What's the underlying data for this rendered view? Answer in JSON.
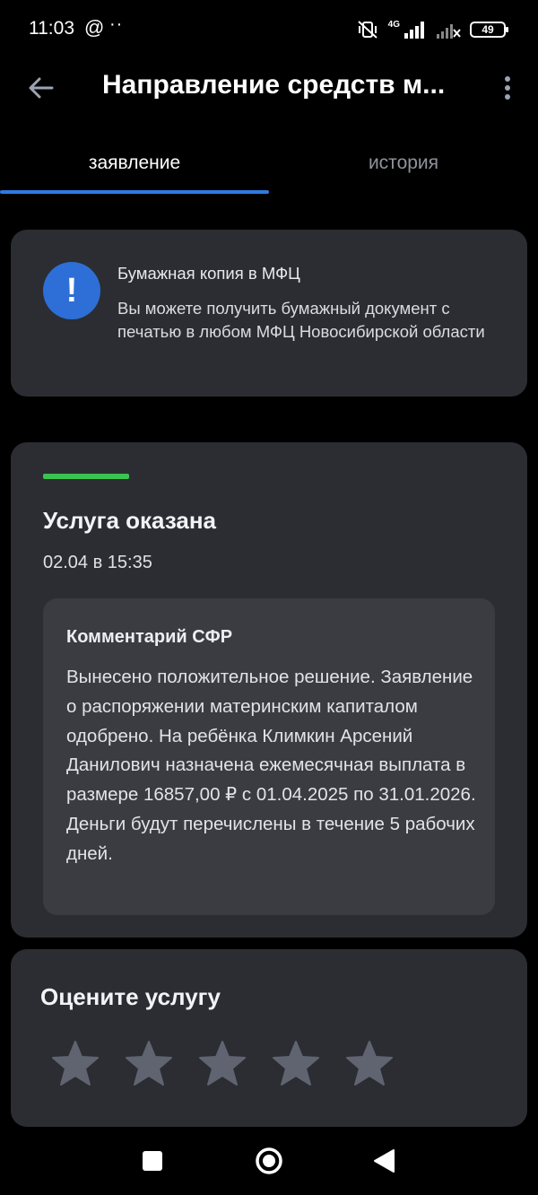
{
  "status_bar": {
    "time": "11:03",
    "at_symbol": "@",
    "dots": "··",
    "network_type": "4G",
    "battery_level": "49"
  },
  "app_bar": {
    "title": "Направление средств м..."
  },
  "tabs": [
    {
      "label": "заявление",
      "active": true
    },
    {
      "label": "история",
      "active": false
    }
  ],
  "info_card": {
    "icon_glyph": "!",
    "title": "Бумажная копия в МФЦ",
    "text": "Вы можете получить бумажный документ с печатью в любом МФЦ Новосибирской области"
  },
  "status_card": {
    "status": "Услуга оказана",
    "date": "02.04 в 15:35",
    "comment_title": "Комментарий СФР",
    "comment_text": "Вынесено положительное решение. Заявление о распоряжении материнским капиталом одобрено. На ребёнка Климкин Арсений Данилович назначена ежемесячная выплата в размере 16857,00 ₽ с 01.04.2025 по 31.01.2026. Деньги будут перечислены в течение 5 рабочих дней."
  },
  "rating": {
    "title": "Оцените услугу",
    "value": 0,
    "max": 5
  },
  "colors": {
    "background": "#000000",
    "card": "#2b2d33",
    "comment_box": "#3a3c42",
    "accent": "#2f7ae5",
    "info_icon": "#2d6fd6",
    "success": "#3bc24f",
    "star_inactive": "#5f6470"
  }
}
